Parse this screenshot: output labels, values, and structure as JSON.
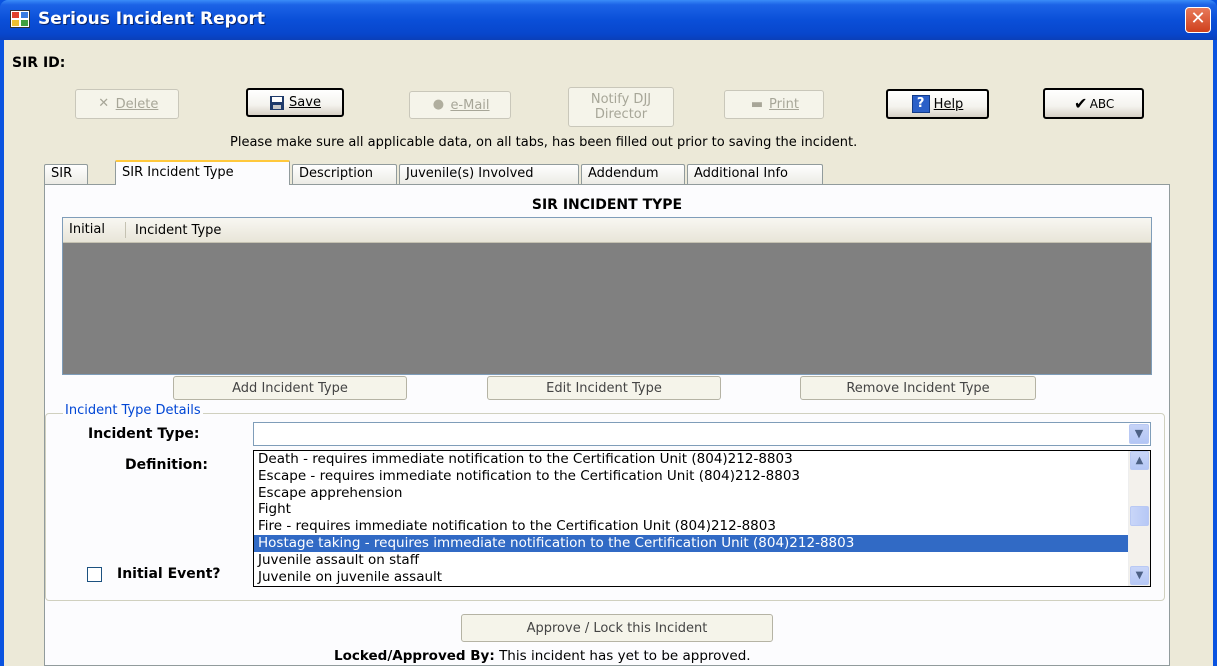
{
  "window": {
    "title": "Serious Incident Report",
    "close_glyph": "✕"
  },
  "header": {
    "sir_id_label": "SIR ID:"
  },
  "toolbar": {
    "delete_label": "Delete",
    "save_label": "Save",
    "email_label": "e-Mail",
    "notify_label_line1": "Notify DJJ",
    "notify_label_line2": "Director",
    "print_label": "Print",
    "help_label": "Help",
    "spell_label": "ABC"
  },
  "notice": "Please make sure all applicable data, on all tabs, has been filled out prior to saving the incident.",
  "tabs": [
    "SIR",
    "SIR Incident Type",
    "Description",
    "Juvenile(s) Involved",
    "Addendum",
    "Additional Info"
  ],
  "panel": {
    "title": "SIR INCIDENT TYPE",
    "grid_columns": [
      "Initial",
      "Incident Type"
    ],
    "add_label": "Add Incident Type",
    "edit_label": "Edit Incident Type",
    "remove_label": "Remove Incident Type"
  },
  "details": {
    "legend": "Incident Type Details",
    "incident_type_label": "Incident Type:",
    "incident_type_value": "",
    "definition_label": "Definition:",
    "initial_event_label": "Initial Event?",
    "initial_event_checked": false,
    "options": [
      "Death - requires immediate notification to the Certification Unit (804)212-8803",
      "Escape - requires immediate notification to the Certification Unit (804)212-8803",
      "Escape apprehension",
      "Fight",
      "Fire - requires immediate notification to the Certification Unit (804)212-8803",
      "Hostage taking - requires immediate notification to the Certification Unit (804)212-8803",
      "Juvenile assault on staff",
      "Juvenile on juvenile assault"
    ],
    "selected_index": 5
  },
  "footer": {
    "approve_label": "Approve / Lock this Incident",
    "locked_label": "Locked/Approved By:",
    "locked_value": "This incident has yet to be approved."
  }
}
